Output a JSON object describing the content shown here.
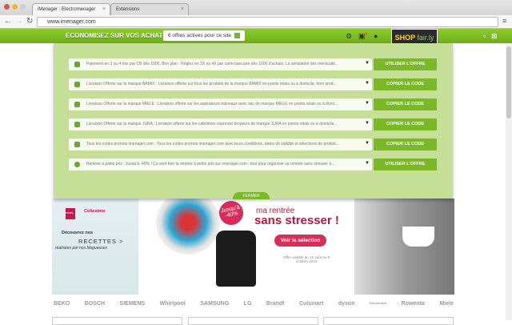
{
  "browser": {
    "tabs": [
      {
        "label": "iMenager : Electromenager"
      },
      {
        "label": "Extensions"
      }
    ],
    "url": "www.imenager.com"
  },
  "extension_bar": {
    "slogan": "ECONOMISEZ SUR VOS ACHATS",
    "offers_count": "6 offres actives pour ce site",
    "brand": "SHOP",
    "brand_suffix": "fair.ly",
    "notification_count": "6"
  },
  "offers": [
    {
      "text": "Paiement en 3 ou 4 fois par CB dès 100€. Bon plan : Réglez en 3X ou 4X par carte bancaire dès 100€ d'achats. La simulation des mensualit...",
      "button": "UTILISER L'OFFRE"
    },
    {
      "text": "Livraison Offerte sur la marque BAMIX : Livraison offerte sur tous les produits de la marque BAMIX en points relais ou à domicile, hors prod...",
      "button": "COPIER LE CODE"
    },
    {
      "text": "Livraison Offerte sur la marque MIELE : Livraison offerte sur les aspirateurs traineaux avec sac de marque MIELE en points relais ou à domi...",
      "button": "COPIER LE CODE"
    },
    {
      "text": "Livraison Offerte sur la marque JURA : Livraison offerte sur les cafetières expresso broyeurs de marque JURA en points relais ou à domicile...",
      "button": "COPIER LE CODE"
    },
    {
      "text": "Tous les codes promos imenager.com : Tous les codes promos imenager.com avec leurs conditions, dates de validité et sélections de produit...",
      "button": "COPIER LE CODE"
    },
    {
      "text": "Rentrée à petits prix : Jusqu'à -40% ! Ça sent bon la rentrée à petits prix sur imenager.com : tout pour organiser sa rentrée sans stresser à...",
      "button": "UTILISER L'OFFRE"
    }
  ],
  "close_label": "FERMER",
  "banner": {
    "left": {
      "delivery": "Colissimo",
      "relais": "relais",
      "discover": "Découvrez nos",
      "recipes": "RECETTES >",
      "by": "réalisées par nos blogueuses"
    },
    "badge": "Jusqu'à -40%",
    "headline1": "ma rentrée",
    "headline2": "sans stresser !",
    "cta": "Voir la sélection",
    "validity": "Offre valable du 12 août au 9 octobre 2013"
  },
  "brands": [
    "BEKO",
    "BOSCH",
    "SIEMENS",
    "Whirlpool",
    "SAMSUNG",
    "LG",
    "Brandt",
    "Cuisinart",
    "dyson",
    "KitchenAid",
    "Rowenta",
    "Miele"
  ]
}
